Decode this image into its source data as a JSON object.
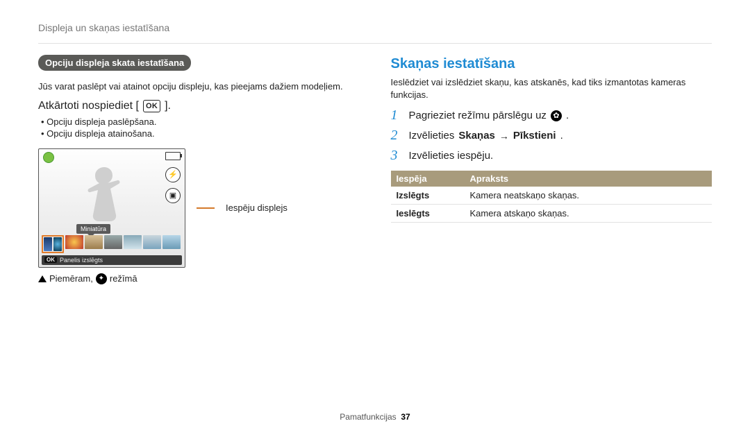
{
  "breadcrumb": "Displeja un skaņas iestatīšana",
  "left": {
    "pill": "Opciju displeja skata iestatīšana",
    "intro": "Jūs varat paslēpt vai atainot opciju displeju, kas pieejams dažiem modeļiem.",
    "press_label_pre": "Atkārtoti nospiediet [",
    "ok": "OK",
    "press_label_post": "].",
    "bullets": [
      "Opciju displeja paslēpšana.",
      "Opciju displeja atainošana."
    ],
    "screen": {
      "miniatura": "Miniatūra",
      "footer_ok": "OK",
      "footer_text": "Panelis izslēgts"
    },
    "callout": "Iespēju displejs",
    "example_pre": "Piemēram,",
    "example_post": "režīmā"
  },
  "right": {
    "heading": "Skaņas iestatīšana",
    "intro": "Ieslēdziet vai izslēdziet skaņu, kas atskanēs, kad tiks izmantotas kameras funkcijas.",
    "steps": [
      {
        "n": "1",
        "pre": "Pagrieziet režīmu pārslēgu uz",
        "icon": "gear",
        "post": "."
      },
      {
        "n": "2",
        "pre": "Izvēlieties",
        "b1": "Skaņas",
        "arrow": "→",
        "b2": "Pīkstieni",
        "post": "."
      },
      {
        "n": "3",
        "pre": "Izvēlieties iespēju.",
        "post": ""
      }
    ],
    "table": {
      "head": {
        "opt": "Iespēja",
        "desc": "Apraksts"
      },
      "rows": [
        {
          "opt": "Izslēgts",
          "desc": "Kamera neatskaņo skaņas."
        },
        {
          "opt": "Ieslēgts",
          "desc": "Kamera atskaņo skaņas."
        }
      ]
    }
  },
  "footer": {
    "label": "Pamatfunkcijas",
    "page": "37"
  }
}
